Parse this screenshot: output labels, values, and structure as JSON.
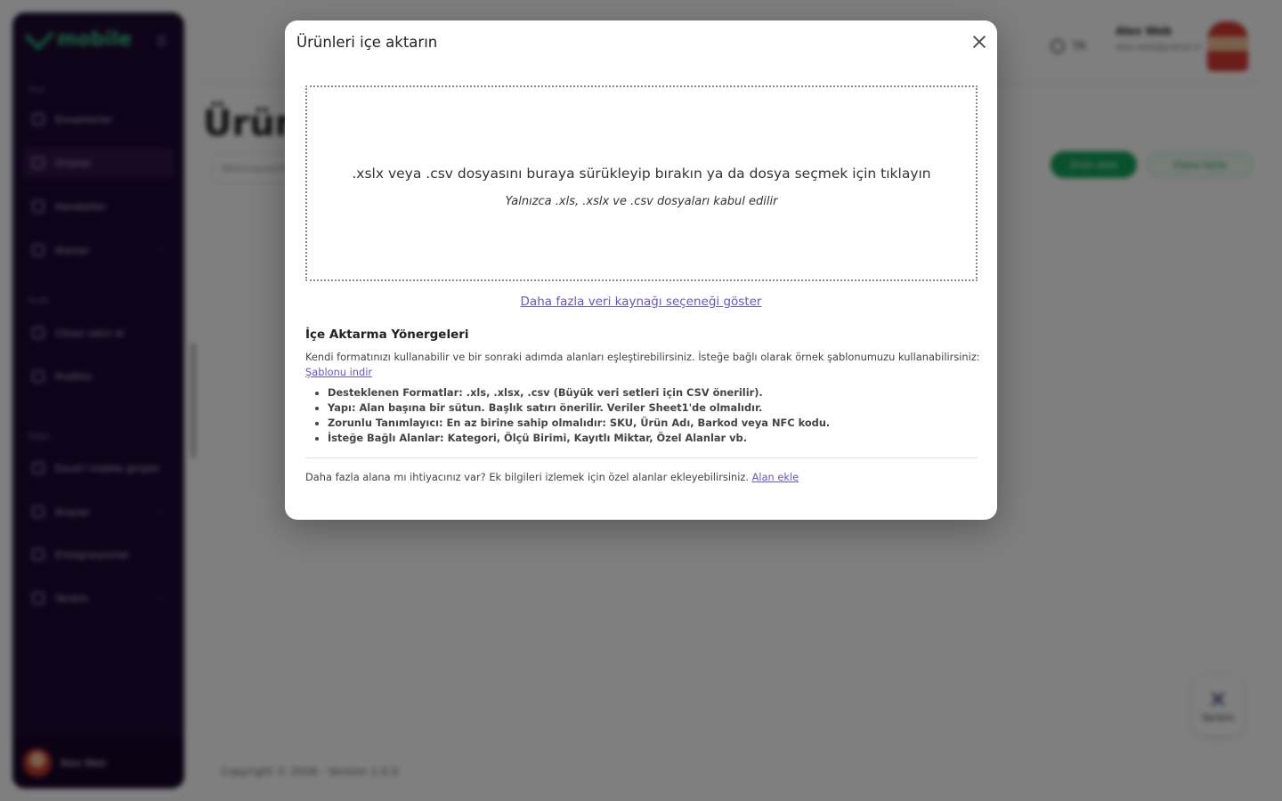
{
  "app": {
    "logo_text": "mobile",
    "sidebar": {
      "sections": [
        "Ana",
        "Profil",
        "Diğer"
      ],
      "items": [
        {
          "label": "Envanterler"
        },
        {
          "label": "Ürünler"
        },
        {
          "label": "Hareketler"
        },
        {
          "label": "Alanlar"
        },
        {
          "label": "Cihazı satın al"
        },
        {
          "label": "Profilim"
        },
        {
          "label": "Excel'i mobile girişler"
        },
        {
          "label": "Araçlar"
        },
        {
          "label": "Entegrasyonlar"
        },
        {
          "label": "Yardım"
        }
      ],
      "user_name": "Alex Web"
    },
    "topbar": {
      "language": "TR",
      "user_name": "Alex Web",
      "user_email": "alex-web@yahoo.tr"
    },
    "page_title": "Ürün",
    "search_placeholder": "Webimpozitif",
    "primary_button": "Ürün ekle",
    "secondary_button": "Daha fazla",
    "footer": "Copyright © 2026 - Version 1.0.0",
    "help_label": "Yardım"
  },
  "modal": {
    "title": "Ürünleri içe aktarın",
    "dropzone_text": ".xslx veya .csv dosyasını buraya sürükleyip bırakın ya da dosya seçmek için tıklayın",
    "dropzone_hint": "Yalnızca .xls, .xslx ve .csv dosyaları kabul edilir",
    "more_sources_link": "Daha fazla veri kaynağı seçeneği göster",
    "guide_title": "İçe Aktarma Yönergeleri",
    "guide_description": "Kendi formatınızı kullanabilir ve bir sonraki adımda alanları eşleştirebilirsiniz. İsteğe bağlı olarak örnek şablonumuzu kullanabilirsiniz:",
    "template_link": "Şablonu indir",
    "guide_items": [
      "Desteklenen Formatlar: .xls, .xlsx, .csv (Büyük veri setleri için CSV önerilir).",
      "Yapı: Alan başına bir sütun. Başlık satırı önerilir. Veriler Sheet1'de olmalıdır.",
      "Zorunlu Tanımlayıcı: En az birine sahip olmalıdır: SKU, Ürün Adı, Barkod veya NFC kodu.",
      "İsteğe Bağlı Alanlar: Kategori, Ölçü Birimi, Kayıtlı Miktar, Özel Alanlar vb."
    ],
    "extra_fields_text": "Daha fazla alana mı ihtiyacınız var? Ek bilgileri izlemek için özel alanlar ekleyebilirsiniz.",
    "add_field_link": "Alan ekle"
  },
  "colors": {
    "sidebar_bg": "#1f0733",
    "accent_green": "#10a35b",
    "link": "#6a56c2"
  }
}
